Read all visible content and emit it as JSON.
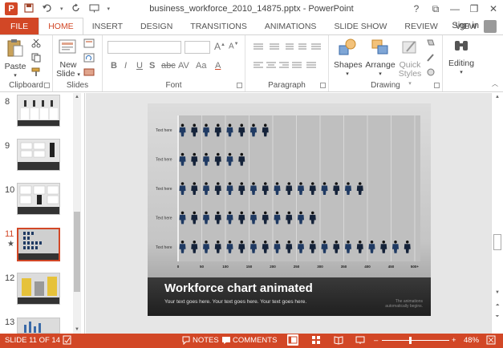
{
  "window": {
    "title": "business_workforce_2010_14875.pptx - PowerPoint",
    "app_icon": "P",
    "controls": [
      "?",
      "⧉",
      "—",
      "❐",
      "✕"
    ]
  },
  "qat": {
    "save_icon": "save-icon",
    "undo_icon": "undo-icon",
    "redo_icon": "repeat-icon",
    "present_icon": "present-icon"
  },
  "tabs": [
    {
      "label": "FILE"
    },
    {
      "label": "HOME"
    },
    {
      "label": "INSERT"
    },
    {
      "label": "DESIGN"
    },
    {
      "label": "TRANSITIONS"
    },
    {
      "label": "ANIMATIONS"
    },
    {
      "label": "SLIDE SHOW"
    },
    {
      "label": "REVIEW"
    },
    {
      "label": "VIEW"
    }
  ],
  "signin": "Sign in",
  "ribbon": {
    "clipboard": {
      "label": "Clipboard",
      "paste": "Paste"
    },
    "slides": {
      "label": "Slides",
      "new_slide_line1": "New",
      "new_slide_line2": "Slide"
    },
    "font": {
      "label": "Font",
      "bold": "B",
      "italic": "I",
      "underline": "U",
      "strike": "S",
      "shadow": "abc",
      "spacing": "AV",
      "case": "Aa",
      "color": "A",
      "grow": "A",
      "shrink": "A"
    },
    "paragraph": {
      "label": "Paragraph"
    },
    "drawing": {
      "label": "Drawing",
      "shapes": "Shapes",
      "arrange": "Arrange",
      "quick_line1": "Quick",
      "quick_line2": "Styles"
    },
    "editing": {
      "label": "Editing"
    }
  },
  "thumbnails": [
    {
      "num": "8"
    },
    {
      "num": "9"
    },
    {
      "num": "10"
    },
    {
      "num": "11",
      "star": "★"
    },
    {
      "num": "12"
    },
    {
      "num": "13"
    }
  ],
  "slide": {
    "title": "Workforce chart animated",
    "subtitle": "Your text goes here. Your text goes here. Your text goes here.",
    "note": "The animations automatically begins."
  },
  "chart_data": {
    "type": "bar",
    "categories": [
      "Text here",
      "Text here",
      "Text here",
      "Text here",
      "Text here"
    ],
    "values": [
      200,
      150,
      400,
      300,
      500
    ],
    "tick_labels": [
      "0",
      "50",
      "100",
      "150",
      "200",
      "250",
      "300",
      "350",
      "400",
      "450",
      "500+"
    ],
    "xlim": [
      0,
      500
    ],
    "orientation": "horizontal",
    "grid": true
  },
  "status": {
    "slide": "SLIDE 11 OF 14",
    "notes": "NOTES",
    "comments": "COMMENTS",
    "zoom": "48%",
    "minus": "–",
    "plus": "+"
  },
  "colors": {
    "accent": "#d24726",
    "figure": "#1f3a63"
  }
}
